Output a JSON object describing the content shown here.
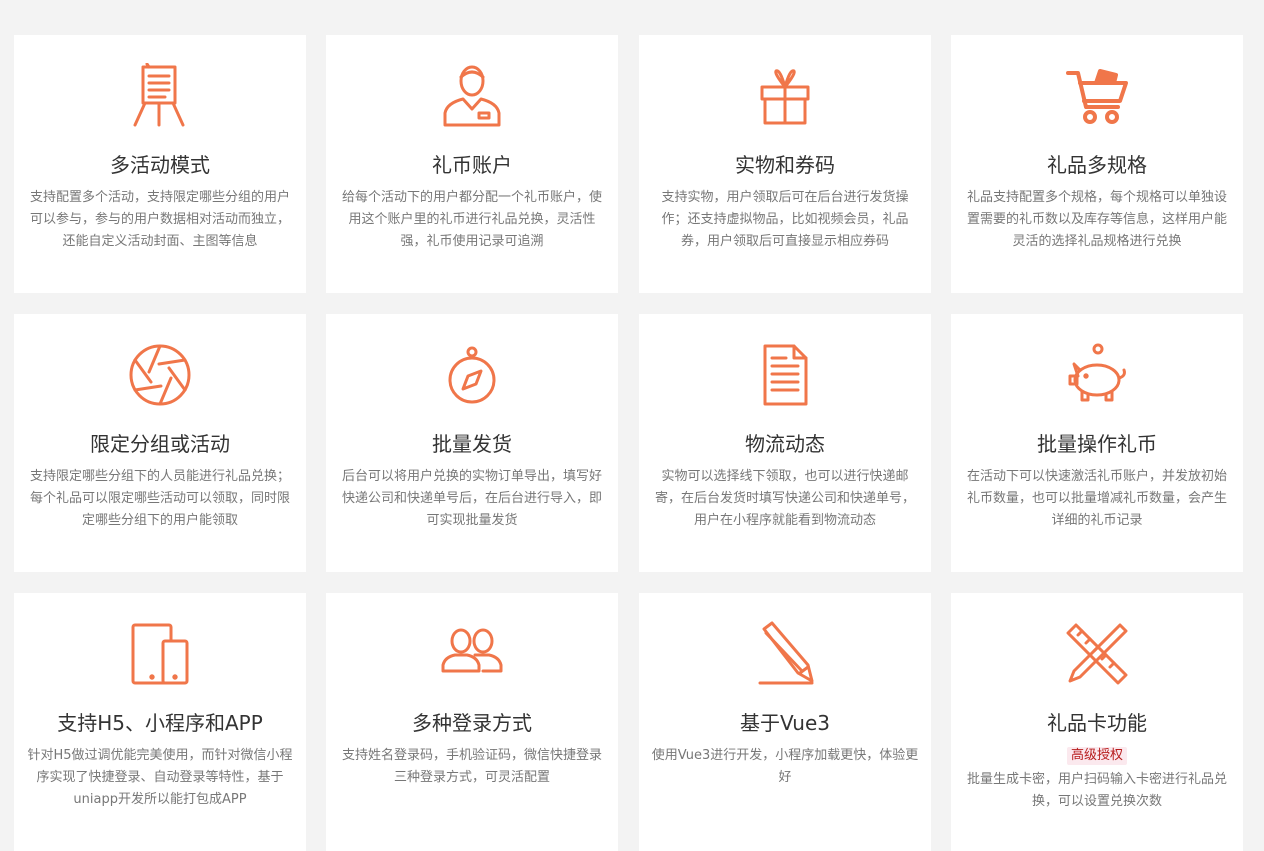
{
  "accent": "#f0764a",
  "features": [
    {
      "title": "多活动模式",
      "icon": "easel-board-icon",
      "desc": "支持配置多个活动，支持限定哪些分组的用户可以参与，参与的用户数据相对活动而独立，还能自定义活动封面、主图等信息"
    },
    {
      "title": "礼币账户",
      "icon": "user-account-icon",
      "desc": "给每个活动下的用户都分配一个礼币账户，使用这个账户里的礼币进行礼品兑换，灵活性强，礼币使用记录可追溯"
    },
    {
      "title": "实物和券码",
      "icon": "gift-box-icon",
      "desc": "支持实物，用户领取后可在后台进行发货操作；还支持虚拟物品，比如视频会员，礼品券，用户领取后可直接显示相应券码"
    },
    {
      "title": "礼品多规格",
      "icon": "shopping-cart-icon",
      "desc": "礼品支持配置多个规格，每个规格可以单独设置需要的礼币数以及库存等信息，这样用户能灵活的选择礼品规格进行兑换"
    },
    {
      "title": "限定分组或活动",
      "icon": "aperture-icon",
      "desc": "支持限定哪些分组下的人员能进行礼品兑换；每个礼品可以限定哪些活动可以领取，同时限定哪些分组下的用户能领取"
    },
    {
      "title": "批量发货",
      "icon": "compass-icon",
      "desc": "后台可以将用户兑换的实物订单导出，填写好快递公司和快递单号后，在后台进行导入，即可实现批量发货"
    },
    {
      "title": "物流动态",
      "icon": "document-icon",
      "desc": "实物可以选择线下领取，也可以进行快递邮寄，在后台发货时填写快递公司和快递单号，用户在小程序就能看到物流动态"
    },
    {
      "title": "批量操作礼币",
      "icon": "piggy-bank-icon",
      "desc": "在活动下可以快速激活礼币账户，并发放初始礼币数量，也可以批量增减礼币数量，会产生详细的礼币记录"
    },
    {
      "title": "支持H5、小程序和APP",
      "icon": "devices-icon",
      "desc": "针对H5做过调优能完美使用，而针对微信小程序实现了快捷登录、自动登录等特性，基于uniapp开发所以能打包成APP"
    },
    {
      "title": "多种登录方式",
      "icon": "users-icon",
      "desc": "支持姓名登录码，手机验证码，微信快捷登录三种登录方式，可灵活配置"
    },
    {
      "title": "基于Vue3",
      "icon": "pencil-icon",
      "desc": "使用Vue3进行开发，小程序加载更快，体验更好"
    },
    {
      "title": "礼品卡功能",
      "icon": "ruler-pencil-icon",
      "badge": "高级授权",
      "desc": "批量生成卡密，用户扫码输入卡密进行礼品兑换，可以设置兑换次数"
    }
  ]
}
